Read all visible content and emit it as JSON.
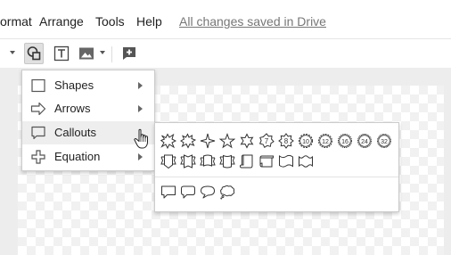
{
  "menubar": {
    "items": [
      "ormat",
      "Arrange",
      "Tools",
      "Help"
    ],
    "save_status": "All changes saved in Drive"
  },
  "toolbar": {
    "buttons": [
      "shapes-icon",
      "text-box-icon",
      "image-icon",
      "insert-comment-icon"
    ]
  },
  "shape_menu": {
    "items": [
      {
        "label": "Shapes",
        "icon": "rectangle-icon",
        "submenu": true
      },
      {
        "label": "Arrows",
        "icon": "arrow-icon",
        "submenu": true
      },
      {
        "label": "Callouts",
        "icon": "callout-icon",
        "submenu": true
      },
      {
        "label": "Equation",
        "icon": "plus-icon",
        "submenu": true
      }
    ],
    "hovered": "Callouts"
  },
  "stars_palette": {
    "star_badges": [
      "7",
      "8",
      "10",
      "12",
      "16",
      "24",
      "32"
    ]
  }
}
